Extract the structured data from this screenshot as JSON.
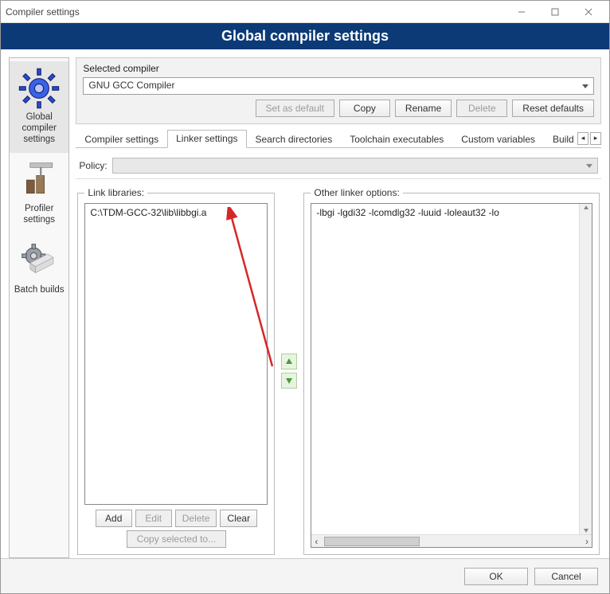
{
  "window": {
    "title": "Compiler settings"
  },
  "banner": "Global compiler settings",
  "sidebar": {
    "items": [
      {
        "label": "Global compiler settings",
        "selected": true
      },
      {
        "label": "Profiler settings",
        "selected": false
      },
      {
        "label": "Batch builds",
        "selected": false
      }
    ]
  },
  "selected_compiler": {
    "label": "Selected compiler",
    "value": "GNU GCC Compiler",
    "buttons": {
      "set_default": "Set as default",
      "copy": "Copy",
      "rename": "Rename",
      "delete": "Delete",
      "reset": "Reset defaults"
    }
  },
  "tabs": [
    {
      "label": "Compiler settings",
      "active": false
    },
    {
      "label": "Linker settings",
      "active": true
    },
    {
      "label": "Search directories",
      "active": false
    },
    {
      "label": "Toolchain executables",
      "active": false
    },
    {
      "label": "Custom variables",
      "active": false
    },
    {
      "label": "Build options",
      "active": false
    }
  ],
  "policy": {
    "label": "Policy:",
    "value": ""
  },
  "link_libraries": {
    "legend": "Link libraries:",
    "items": [
      "C:\\TDM-GCC-32\\lib\\libbgi.a"
    ],
    "buttons": {
      "add": "Add",
      "edit": "Edit",
      "delete": "Delete",
      "clear": "Clear",
      "copy": "Copy selected to..."
    }
  },
  "other_linker": {
    "legend": "Other linker options:",
    "text": "-lbgi -lgdi32 -lcomdlg32 -luuid -loleaut32 -lo"
  },
  "footer": {
    "ok": "OK",
    "cancel": "Cancel"
  }
}
